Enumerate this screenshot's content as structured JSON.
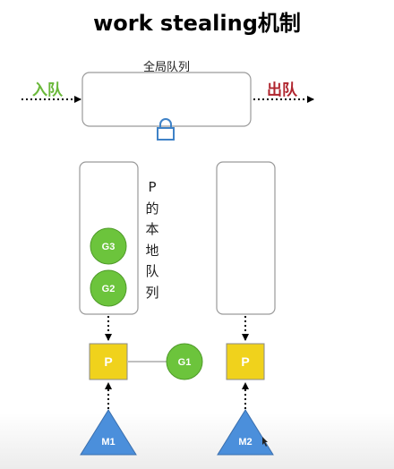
{
  "title": "work stealing机制",
  "global_queue": {
    "label": "全局队列",
    "enqueue_label": "入队",
    "dequeue_label": "出队"
  },
  "local_queue_label": [
    "P",
    "的",
    "本",
    "地",
    "队",
    "列"
  ],
  "goroutines": {
    "g3": "G3",
    "g2": "G2",
    "g1": "G1"
  },
  "processors": {
    "p1": "P",
    "p2": "P"
  },
  "machines": {
    "m1": "M1",
    "m2": "M2"
  },
  "colors": {
    "enqueue": "#6ab83a",
    "dequeue": "#b0262f",
    "lock": "#3f82c7",
    "goroutine": "#6cc43c",
    "processor": "#f0d21c",
    "machine": "#4b8fdb",
    "box_border": "#9a9a9a"
  }
}
